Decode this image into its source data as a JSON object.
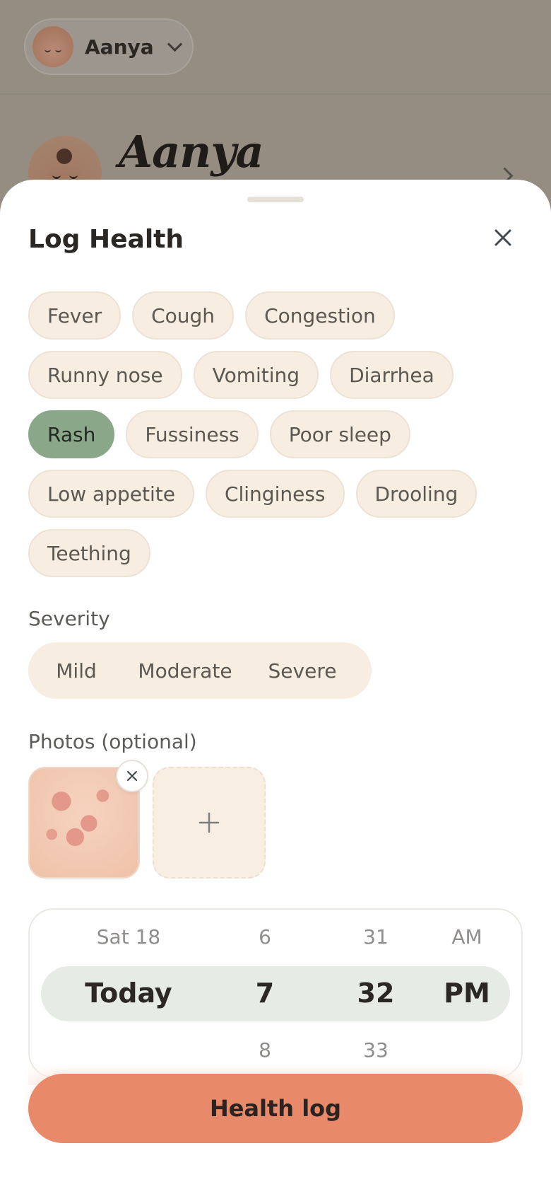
{
  "background": {
    "switcher_name": "Aanya",
    "profile_name": "Aanya"
  },
  "sheet": {
    "title": "Log Health",
    "symptoms": [
      {
        "label": "Fever",
        "selected": false
      },
      {
        "label": "Cough",
        "selected": false
      },
      {
        "label": "Congestion",
        "selected": false
      },
      {
        "label": "Runny nose",
        "selected": false
      },
      {
        "label": "Vomiting",
        "selected": false
      },
      {
        "label": "Diarrhea",
        "selected": false
      },
      {
        "label": "Rash",
        "selected": true
      },
      {
        "label": "Fussiness",
        "selected": false
      },
      {
        "label": "Poor sleep",
        "selected": false
      },
      {
        "label": "Low appetite",
        "selected": false
      },
      {
        "label": "Clinginess",
        "selected": false
      },
      {
        "label": "Drooling",
        "selected": false
      },
      {
        "label": "Teething",
        "selected": false
      }
    ],
    "severity": {
      "label": "Severity",
      "options": [
        "Mild",
        "Moderate",
        "Severe"
      ]
    },
    "photos": {
      "label": "Photos (optional)"
    },
    "picker": {
      "date": {
        "above": "Sat 18",
        "selected": "Today",
        "below": ""
      },
      "hour": {
        "above": "6",
        "selected": "7",
        "below": "8"
      },
      "minute": {
        "above": "31",
        "selected": "32",
        "below": "33"
      },
      "ampm": {
        "above": "AM",
        "selected": "PM",
        "below": ""
      }
    },
    "submit_label": "Health log"
  },
  "colors": {
    "accent": "#e8896a",
    "selected_chip": "#8aa78a",
    "chip_bg": "#f7ede0"
  }
}
